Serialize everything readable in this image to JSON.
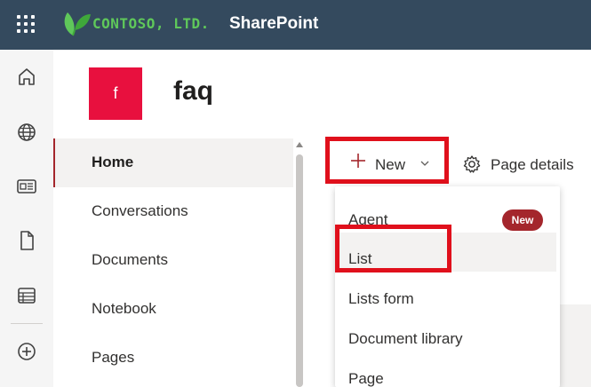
{
  "topbar": {
    "brand": "CONTOSO, LTD.",
    "app_name": "SharePoint",
    "colors": {
      "background": "#344a5e",
      "brand": "#5fc85a"
    }
  },
  "appbar": {
    "icons": [
      "home-icon",
      "globe-icon",
      "news-icon",
      "file-icon",
      "list-icon",
      "add-icon"
    ]
  },
  "site": {
    "logo_letter": "f",
    "title": "faq",
    "logo_color": "#e8103e"
  },
  "nav": {
    "items": [
      {
        "label": "Home",
        "active": true
      },
      {
        "label": "Conversations"
      },
      {
        "label": "Documents"
      },
      {
        "label": "Notebook"
      },
      {
        "label": "Pages"
      }
    ]
  },
  "command_bar": {
    "new_label": "New",
    "page_details_label": "Page details"
  },
  "new_menu": {
    "items": [
      {
        "label": "Agent",
        "badge": "New"
      },
      {
        "label": "List",
        "hovered": true
      },
      {
        "label": "Lists form"
      },
      {
        "label": "Document library"
      },
      {
        "label": "Page"
      }
    ]
  },
  "annotations": {
    "highlight_color": "#e0101c"
  }
}
